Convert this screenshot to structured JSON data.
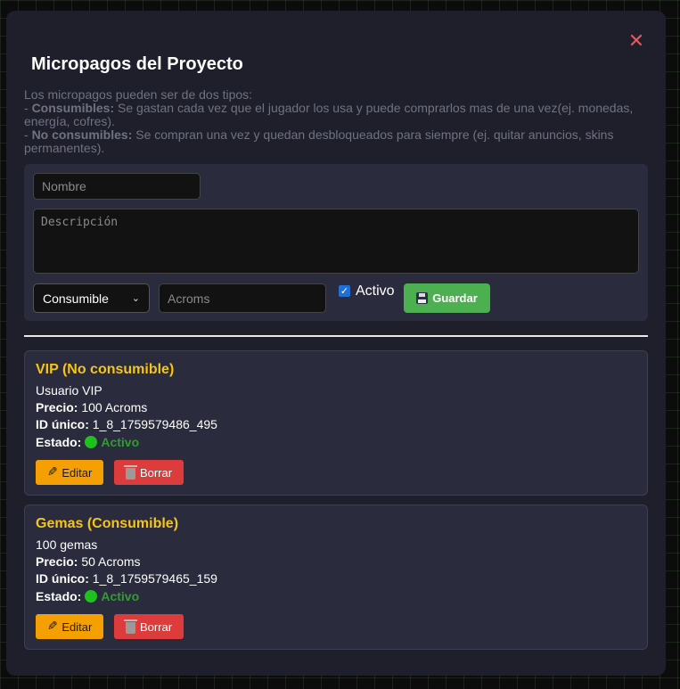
{
  "modal": {
    "close_symbol": "✕",
    "title": "Micropagos del Proyecto",
    "intro": "Los micropagos pueden ser de dos tipos:",
    "consumable_label": "Consumibles:",
    "consumable_text": "Se gastan cada vez que el jugador los usa y puede comprarlos mas de una vez(ej. monedas, energía, cofres).",
    "nonconsumable_label": "No consumibles:",
    "nonconsumable_text": "Se compran una vez y quedan desbloqueados para siempre (ej. quitar anuncios, skins permanentes)."
  },
  "form": {
    "name_placeholder": "Nombre",
    "description_placeholder": "Descripción",
    "type_selected": "Consumible",
    "price_placeholder": "Acroms",
    "active_label": "Activo",
    "active_checked": true,
    "save_label": "Guardar"
  },
  "labels": {
    "price": "Precio:",
    "id": "ID único:",
    "status": "Estado:",
    "edit": "Editar",
    "delete": "Borrar"
  },
  "items": [
    {
      "title": "VIP (No consumible)",
      "description": "Usuario VIP",
      "price": "100 Acroms",
      "id": "1_8_1759579486_495",
      "status": "Activo"
    },
    {
      "title": "Gemas (Consumible)",
      "description": "100 gemas",
      "price": "50 Acroms",
      "id": "1_8_1759579465_159",
      "status": "Activo"
    }
  ],
  "colors": {
    "accent_title": "#f5c518",
    "status_active": "#2e9e2e",
    "save_button": "#4caf50",
    "edit_button": "#f5a000",
    "delete_button": "#dc3c3c"
  }
}
